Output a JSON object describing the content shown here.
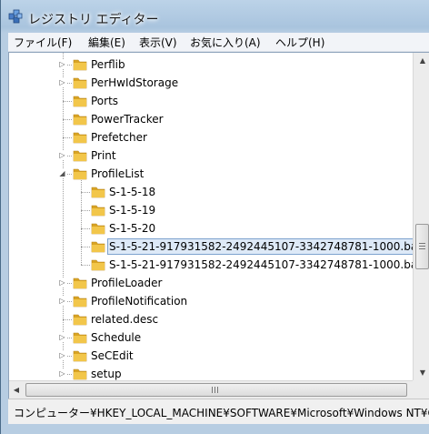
{
  "window": {
    "title": "レジストリ エディター"
  },
  "menu": [
    "ファイル(F)",
    "編集(E)",
    "表示(V)",
    "お気に入り(A)",
    "ヘルプ(H)"
  ],
  "tree": [
    {
      "label": "Perflib",
      "level": 0,
      "expander": "collapsed"
    },
    {
      "label": "PerHwIdStorage",
      "level": 0,
      "expander": "collapsed"
    },
    {
      "label": "Ports",
      "level": 0,
      "expander": "none"
    },
    {
      "label": "PowerTracker",
      "level": 0,
      "expander": "none"
    },
    {
      "label": "Prefetcher",
      "level": 0,
      "expander": "none"
    },
    {
      "label": "Print",
      "level": 0,
      "expander": "collapsed"
    },
    {
      "label": "ProfileList",
      "level": 0,
      "expander": "expanded"
    },
    {
      "label": "S-1-5-18",
      "level": 1,
      "expander": "none"
    },
    {
      "label": "S-1-5-19",
      "level": 1,
      "expander": "none"
    },
    {
      "label": "S-1-5-20",
      "level": 1,
      "expander": "none"
    },
    {
      "label": "S-1-5-21-917931582-2492445107-3342748781-1000.ba",
      "level": 1,
      "expander": "none",
      "selected": true
    },
    {
      "label": "S-1-5-21-917931582-2492445107-3342748781-1000.bak",
      "level": 1,
      "expander": "none"
    },
    {
      "label": "ProfileLoader",
      "level": 0,
      "expander": "collapsed"
    },
    {
      "label": "ProfileNotification",
      "level": 0,
      "expander": "collapsed"
    },
    {
      "label": "related.desc",
      "level": 0,
      "expander": "none"
    },
    {
      "label": "Schedule",
      "level": 0,
      "expander": "collapsed"
    },
    {
      "label": "SeCEdit",
      "level": 0,
      "expander": "collapsed"
    },
    {
      "label": "setup",
      "level": 0,
      "expander": "collapsed"
    }
  ],
  "statusbar": {
    "path": "コンピューター¥HKEY_LOCAL_MACHINE¥SOFTWARE¥Microsoft¥Windows NT¥CurrentVersion¥ProfileList"
  },
  "icons": {
    "folder": "folder-icon",
    "app": "registry-editor-icon"
  },
  "colors": {
    "folder": "#e8b838",
    "selection": "#dde9f7",
    "selection_border": "#7da2ce"
  }
}
